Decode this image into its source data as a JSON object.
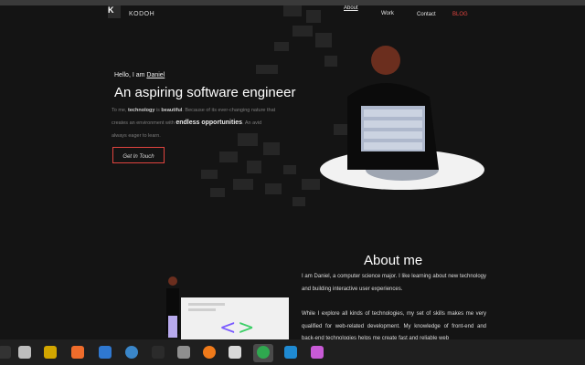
{
  "site": {
    "logo_letter": "K",
    "brand": "KODOH"
  },
  "nav": {
    "about": "About",
    "work": "Work",
    "contact": "Contact",
    "blog": "BLOG",
    "blog_color": "#e0443f"
  },
  "hero": {
    "greeting_prefix": "Hello, I am ",
    "greeting_name": "Daniel",
    "headline": "An aspiring software engineer",
    "para_1a": "To me, ",
    "para_1b": "technology",
    "para_1c": " is ",
    "para_1d": "beautiful",
    "para_1e": ". Because of its ever-changing nature that",
    "para_2a": "creates an environment with ",
    "para_2b": "endless opportunities",
    "para_2c": ". An avid",
    "para_3": "always eager to learn.",
    "cta": "Get In Touch"
  },
  "about": {
    "title": "About me",
    "p1": "I am Daniel, a computer science major. I like learning about new technology and building interactive user experiences.",
    "p2": "While I explore all kinds of technologies, my set of skills makes me very qualified for web-related development. My knowledge of front-end and back-end technologies helps me create fast and reliable web"
  },
  "dock": {
    "icons": [
      "terminal-icon",
      "files-icon",
      "disk-icon",
      "app-store-icon",
      "document-icon",
      "help-icon",
      "console-icon",
      "image-viewer-icon",
      "firefox-icon",
      "presentation-icon",
      "chrome-icon",
      "vscode-icon",
      "video-icon"
    ]
  }
}
